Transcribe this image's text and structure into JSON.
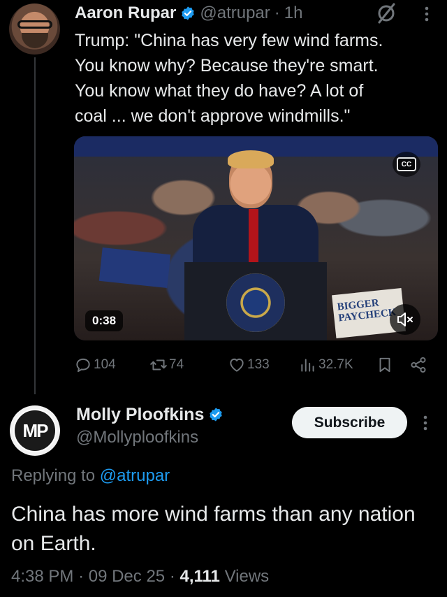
{
  "tweet": {
    "author_name": "Aaron Rupar",
    "handle": "@atrupar",
    "dot": "·",
    "time_ago": "1h",
    "text": "Trump: \"China has very few wind farms.\nYou know why? Because they're smart.\nYou know what they do have? A lot of\ncoal ... we don't approve windmills.\"",
    "video": {
      "duration": "0:38",
      "cc_label": "CC",
      "sign_text": "BIGGER\nPAYCHECK"
    },
    "actions": {
      "replies": "104",
      "reposts": "74",
      "likes": "133",
      "views": "32.7K"
    }
  },
  "reply": {
    "author_name": "Molly Ploofkins",
    "handle": "@Mollyploofkins",
    "avatar_initials": "MP",
    "subscribe_label": "Subscribe",
    "replying_prefix": "Replying to",
    "replying_to": "@atrupar",
    "text": "China has more wind farms than any nation on Earth.",
    "time": "4:38 PM",
    "sep1": "·",
    "date": "09 Dec 25",
    "sep2": "·",
    "views_count": "4,111",
    "views_label": "Views"
  },
  "colors": {
    "background": "#000000",
    "text": "#e7e9ea",
    "muted": "#71767b",
    "accent": "#1d9bf0",
    "thread_line": "#333639"
  },
  "icons": [
    "verified-badge-icon",
    "grok-icon",
    "more-icon",
    "closed-captions-icon",
    "mute-icon",
    "reply-icon",
    "repost-icon",
    "like-icon",
    "views-icon",
    "bookmark-icon",
    "share-icon"
  ]
}
